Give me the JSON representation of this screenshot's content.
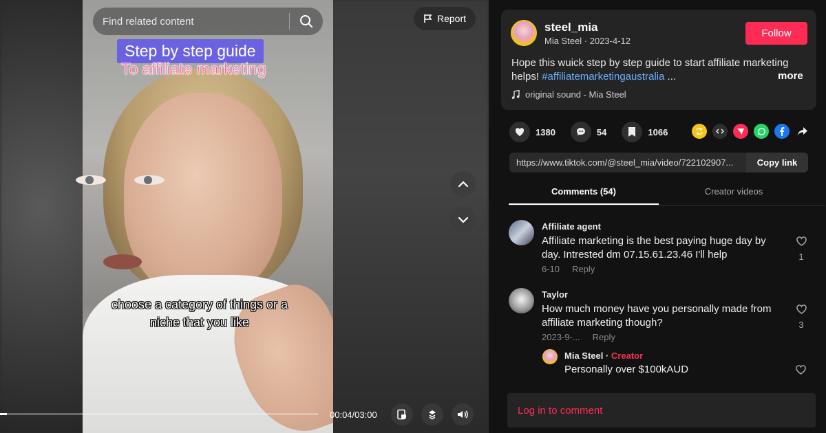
{
  "video": {
    "search_placeholder": "Find related content",
    "report_label": "Report",
    "overlay_line1": "Step by step guide",
    "overlay_line2": "To affiliate marketing",
    "caption": "choose a category of things or a niche that you like",
    "time": "00:04/03:00",
    "progress_fraction": 0.022
  },
  "author": {
    "username": "steel_mia",
    "nickname_date": "Mia Steel · 2023-4-12",
    "follow_label": "Follow",
    "description": "Hope this wuick step by step guide to start affiliate marketing helps! ",
    "hashtag": "#affiliatemarketingaustralia",
    "ellipsis": " ...",
    "more_label": "more",
    "sound": "original sound - Mia Steel"
  },
  "stats": {
    "likes": "1380",
    "comments": "54",
    "saves": "1066"
  },
  "share": {
    "link": "https://www.tiktok.com/@steel_mia/video/722102907...",
    "copy_label": "Copy link",
    "icons": [
      "repost-icon",
      "embed-icon",
      "send-icon",
      "whatsapp-icon",
      "facebook-icon",
      "share-arrow-icon"
    ]
  },
  "tabs": {
    "comments": "Comments (54)",
    "creator_videos": "Creator videos"
  },
  "comments": [
    {
      "name": "Affiliate agent",
      "text": "Affiliate marketing is the best paying huge day by day. Intrested dm 07.15.61.23.46 I'll help",
      "date": "6-10",
      "reply": "Reply",
      "likes": "1"
    },
    {
      "name": "Taylor",
      "text": "How much money have you personally made from affiliate marketing though?",
      "date": "2023-9-...",
      "reply": "Reply",
      "likes": "3"
    }
  ],
  "reply": {
    "name": "Mia Steel",
    "separator": " · ",
    "badge": "Creator",
    "text": "Personally over $100kAUD"
  },
  "login_label": "Log in to comment",
  "colors": {
    "accent": "#fe2c55",
    "hashtag": "#6ab0ff",
    "overlay_purple": "#6b62e0",
    "overlay_pink": "#ff5e9b"
  }
}
